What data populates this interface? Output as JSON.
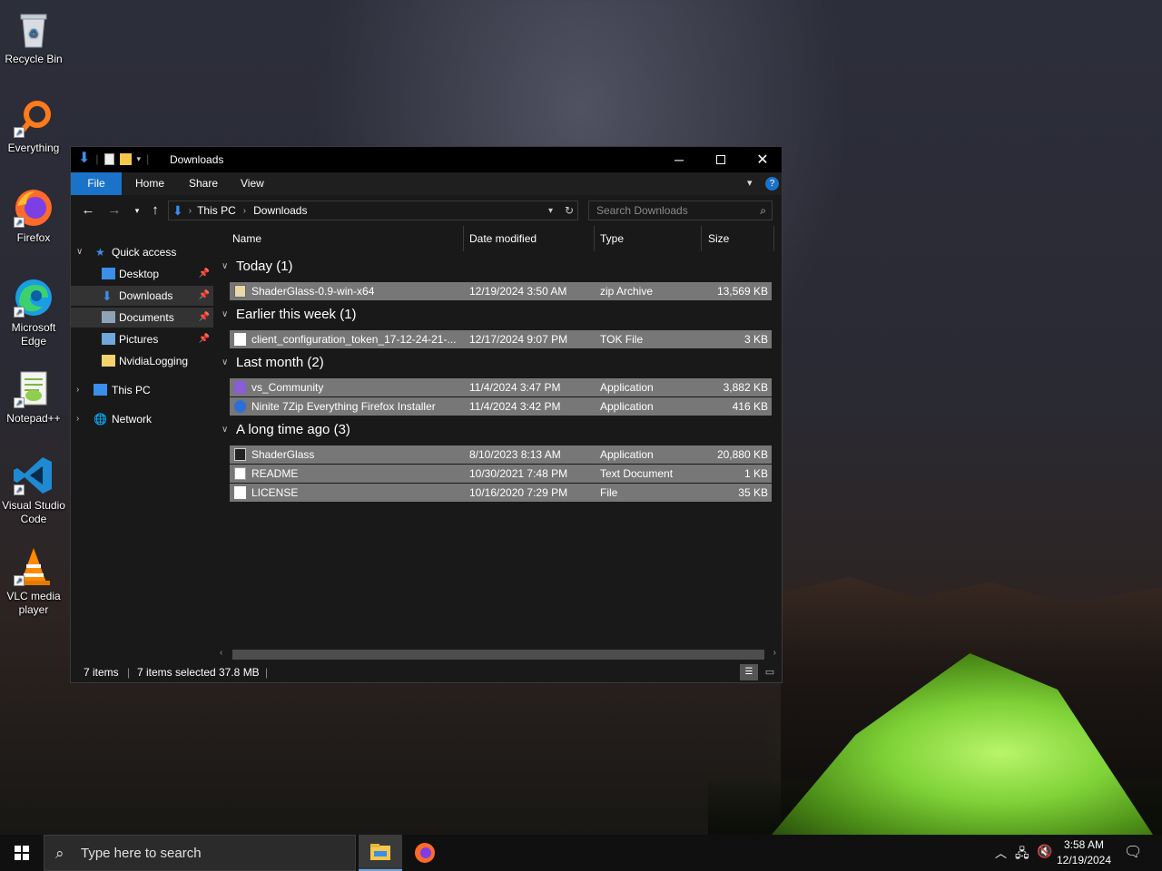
{
  "desktop": {
    "icons": [
      {
        "label": "Recycle Bin"
      },
      {
        "label": "Everything"
      },
      {
        "label": "Firefox"
      },
      {
        "label": "Microsoft Edge"
      },
      {
        "label": "Notepad++"
      },
      {
        "label": "Visual Studio Code"
      },
      {
        "label": "VLC media player"
      }
    ]
  },
  "window": {
    "title": "Downloads",
    "ribbon_tabs": [
      "File",
      "Home",
      "Share",
      "View"
    ],
    "breadcrumb": [
      "This PC",
      "Downloads"
    ],
    "search_placeholder": "Search Downloads",
    "nav": {
      "quick_access": "Quick access",
      "items": [
        "Desktop",
        "Downloads",
        "Documents",
        "Pictures",
        "NvidiaLogging"
      ],
      "this_pc": "This PC",
      "network": "Network"
    },
    "columns": [
      "Name",
      "Date modified",
      "Type",
      "Size"
    ],
    "groups": [
      {
        "label": "Today (1)",
        "files": [
          {
            "name": "ShaderGlass-0.9-win-x64",
            "date": "12/19/2024 3:50 AM",
            "type": "zip Archive",
            "size": "13,569 KB"
          }
        ]
      },
      {
        "label": "Earlier this week (1)",
        "files": [
          {
            "name": "client_configuration_token_17-12-24-21-...",
            "date": "12/17/2024 9:07 PM",
            "type": "TOK File",
            "size": "3 KB"
          }
        ]
      },
      {
        "label": "Last month (2)",
        "files": [
          {
            "name": "vs_Community",
            "date": "11/4/2024 3:47 PM",
            "type": "Application",
            "size": "3,882 KB"
          },
          {
            "name": "Ninite 7Zip Everything Firefox Installer",
            "date": "11/4/2024 3:42 PM",
            "type": "Application",
            "size": "416 KB"
          }
        ]
      },
      {
        "label": "A long time ago (3)",
        "files": [
          {
            "name": "ShaderGlass",
            "date": "8/10/2023 8:13 AM",
            "type": "Application",
            "size": "20,880 KB"
          },
          {
            "name": "README",
            "date": "10/30/2021 7:48 PM",
            "type": "Text Document",
            "size": "1 KB"
          },
          {
            "name": "LICENSE",
            "date": "10/16/2020 7:29 PM",
            "type": "File",
            "size": "35 KB"
          }
        ]
      }
    ],
    "status": {
      "items": "7 items",
      "selected": "7 items selected",
      "size": "37.8 MB"
    }
  },
  "taskbar": {
    "search_placeholder": "Type here to search",
    "time": "3:58 AM",
    "date": "12/19/2024"
  },
  "colors": {
    "accent": "#1a73c9",
    "selection": "#777777",
    "window_bg": "#191919"
  }
}
